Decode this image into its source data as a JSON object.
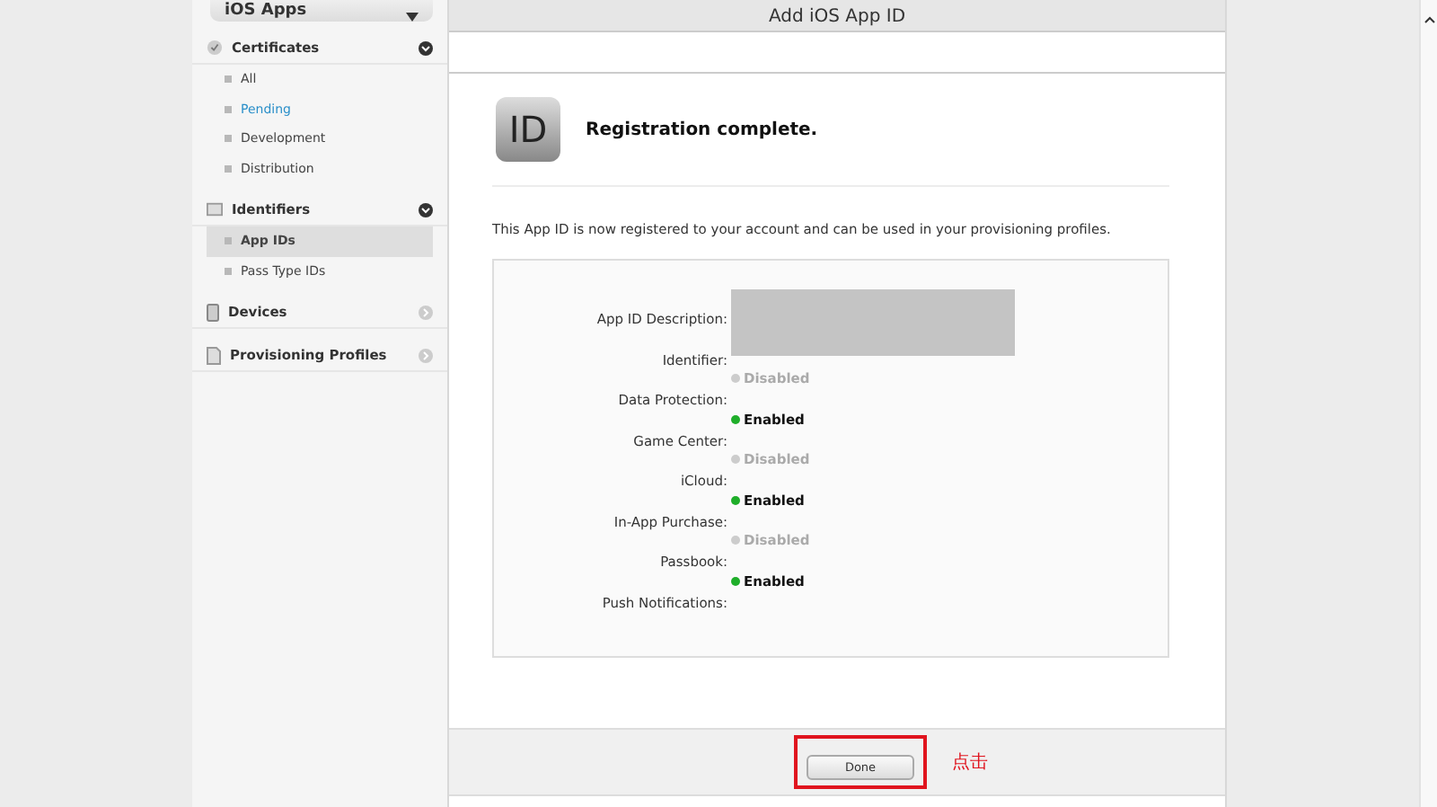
{
  "sidebar": {
    "dropdown": "iOS Apps",
    "sections": [
      {
        "label": "Certificates",
        "expanded": true,
        "kind": "certificate",
        "items": [
          {
            "label": "All",
            "selected": false,
            "highlighted": false
          },
          {
            "label": "Pending",
            "selected": false,
            "highlighted": true
          },
          {
            "label": "Development",
            "selected": false,
            "highlighted": false
          },
          {
            "label": "Distribution",
            "selected": false,
            "highlighted": false
          }
        ]
      },
      {
        "label": "Identifiers",
        "expanded": true,
        "kind": "id",
        "items": [
          {
            "label": "App IDs",
            "selected": true,
            "highlighted": false
          },
          {
            "label": "Pass Type IDs",
            "selected": false,
            "highlighted": false
          }
        ]
      },
      {
        "label": "Devices",
        "expanded": false,
        "kind": "device"
      },
      {
        "label": "Provisioning Profiles",
        "expanded": false,
        "kind": "profile"
      }
    ]
  },
  "header": {
    "title": "Add iOS App ID"
  },
  "content": {
    "icon_text": "ID",
    "heading": "Registration complete.",
    "message": "This App ID is now registered to your account and can be used in your provisioning profiles.",
    "labels": [
      "App ID Description:",
      "Identifier:",
      "Data Protection:",
      "Game Center:",
      "iCloud:",
      "In-App Purchase:",
      "Passbook:",
      "Push Notifications:"
    ],
    "values": [
      {
        "kind": "redacted"
      },
      {
        "kind": "status",
        "text": "Disabled",
        "enabled": false
      },
      {
        "kind": "status",
        "text": "Enabled",
        "enabled": true
      },
      {
        "kind": "status",
        "text": "Disabled",
        "enabled": false
      },
      {
        "kind": "status",
        "text": "Enabled",
        "enabled": true
      },
      {
        "kind": "status",
        "text": "Disabled",
        "enabled": false
      },
      {
        "kind": "status",
        "text": "Enabled",
        "enabled": true
      }
    ]
  },
  "footer": {
    "button": "Done",
    "annotation": "点击"
  }
}
